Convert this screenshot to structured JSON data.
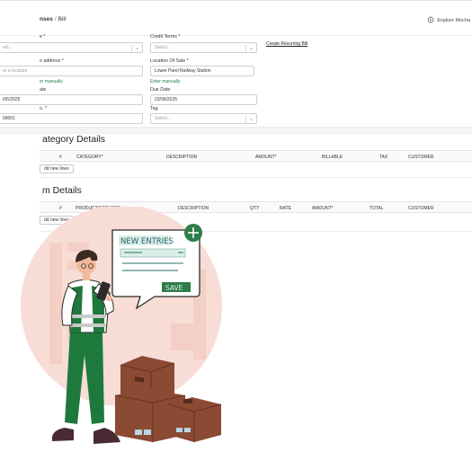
{
  "header": {
    "breadcrumb_parent": "nses",
    "breadcrumb_sep": "/",
    "breadcrumb_current": "Bill",
    "explore_label": "Explore Mocha"
  },
  "form": {
    "vendor_label": "e *",
    "vendor_placeholder": "ect...",
    "credit_terms_label": "Credit Terms *",
    "credit_terms_placeholder": "Select...",
    "create_recurring_link": "Create Recurring Bill",
    "address_label": "e address *",
    "address_placeholder": "er a location",
    "address_manual_link": "er manually",
    "location_of_sale_label": "Location Of Sale *",
    "location_of_sale_value": "Lower Parel Railway Station",
    "location_manual_link": "Enter manually",
    "bill_date_label": "ate",
    "bill_date_value": "/06/2025",
    "due_date_label": "Due Date",
    "due_date_value": "23/06/2025",
    "bill_no_label": "o. *",
    "bill_no_value": "00001",
    "tag_label": "Tag",
    "tag_placeholder": "Select..."
  },
  "category_section": {
    "title": "ategory Details",
    "columns": [
      "#",
      "CATEGORY*",
      "DESCRIPTION",
      "AMOUNT*",
      "BILLABLE",
      "TAX",
      "CUSTOMER"
    ],
    "add_lines_label": "dd new lines"
  },
  "item_section": {
    "title": "m Details",
    "columns": [
      "#",
      "PRODUCT/SERVICE*",
      "DESCRIPTION",
      "QTY",
      "RATE",
      "AMOUNT*",
      "TOTAL",
      "CUSTOMER"
    ],
    "add_lines_label": "dd new lines"
  },
  "illustration": {
    "bubble_title": "NEW ENTRIES",
    "bubble_button": "SAVE",
    "colors": {
      "accent_green": "#2e7d4a",
      "halo": "#f6d9d2",
      "box": "#8a4a33"
    }
  }
}
